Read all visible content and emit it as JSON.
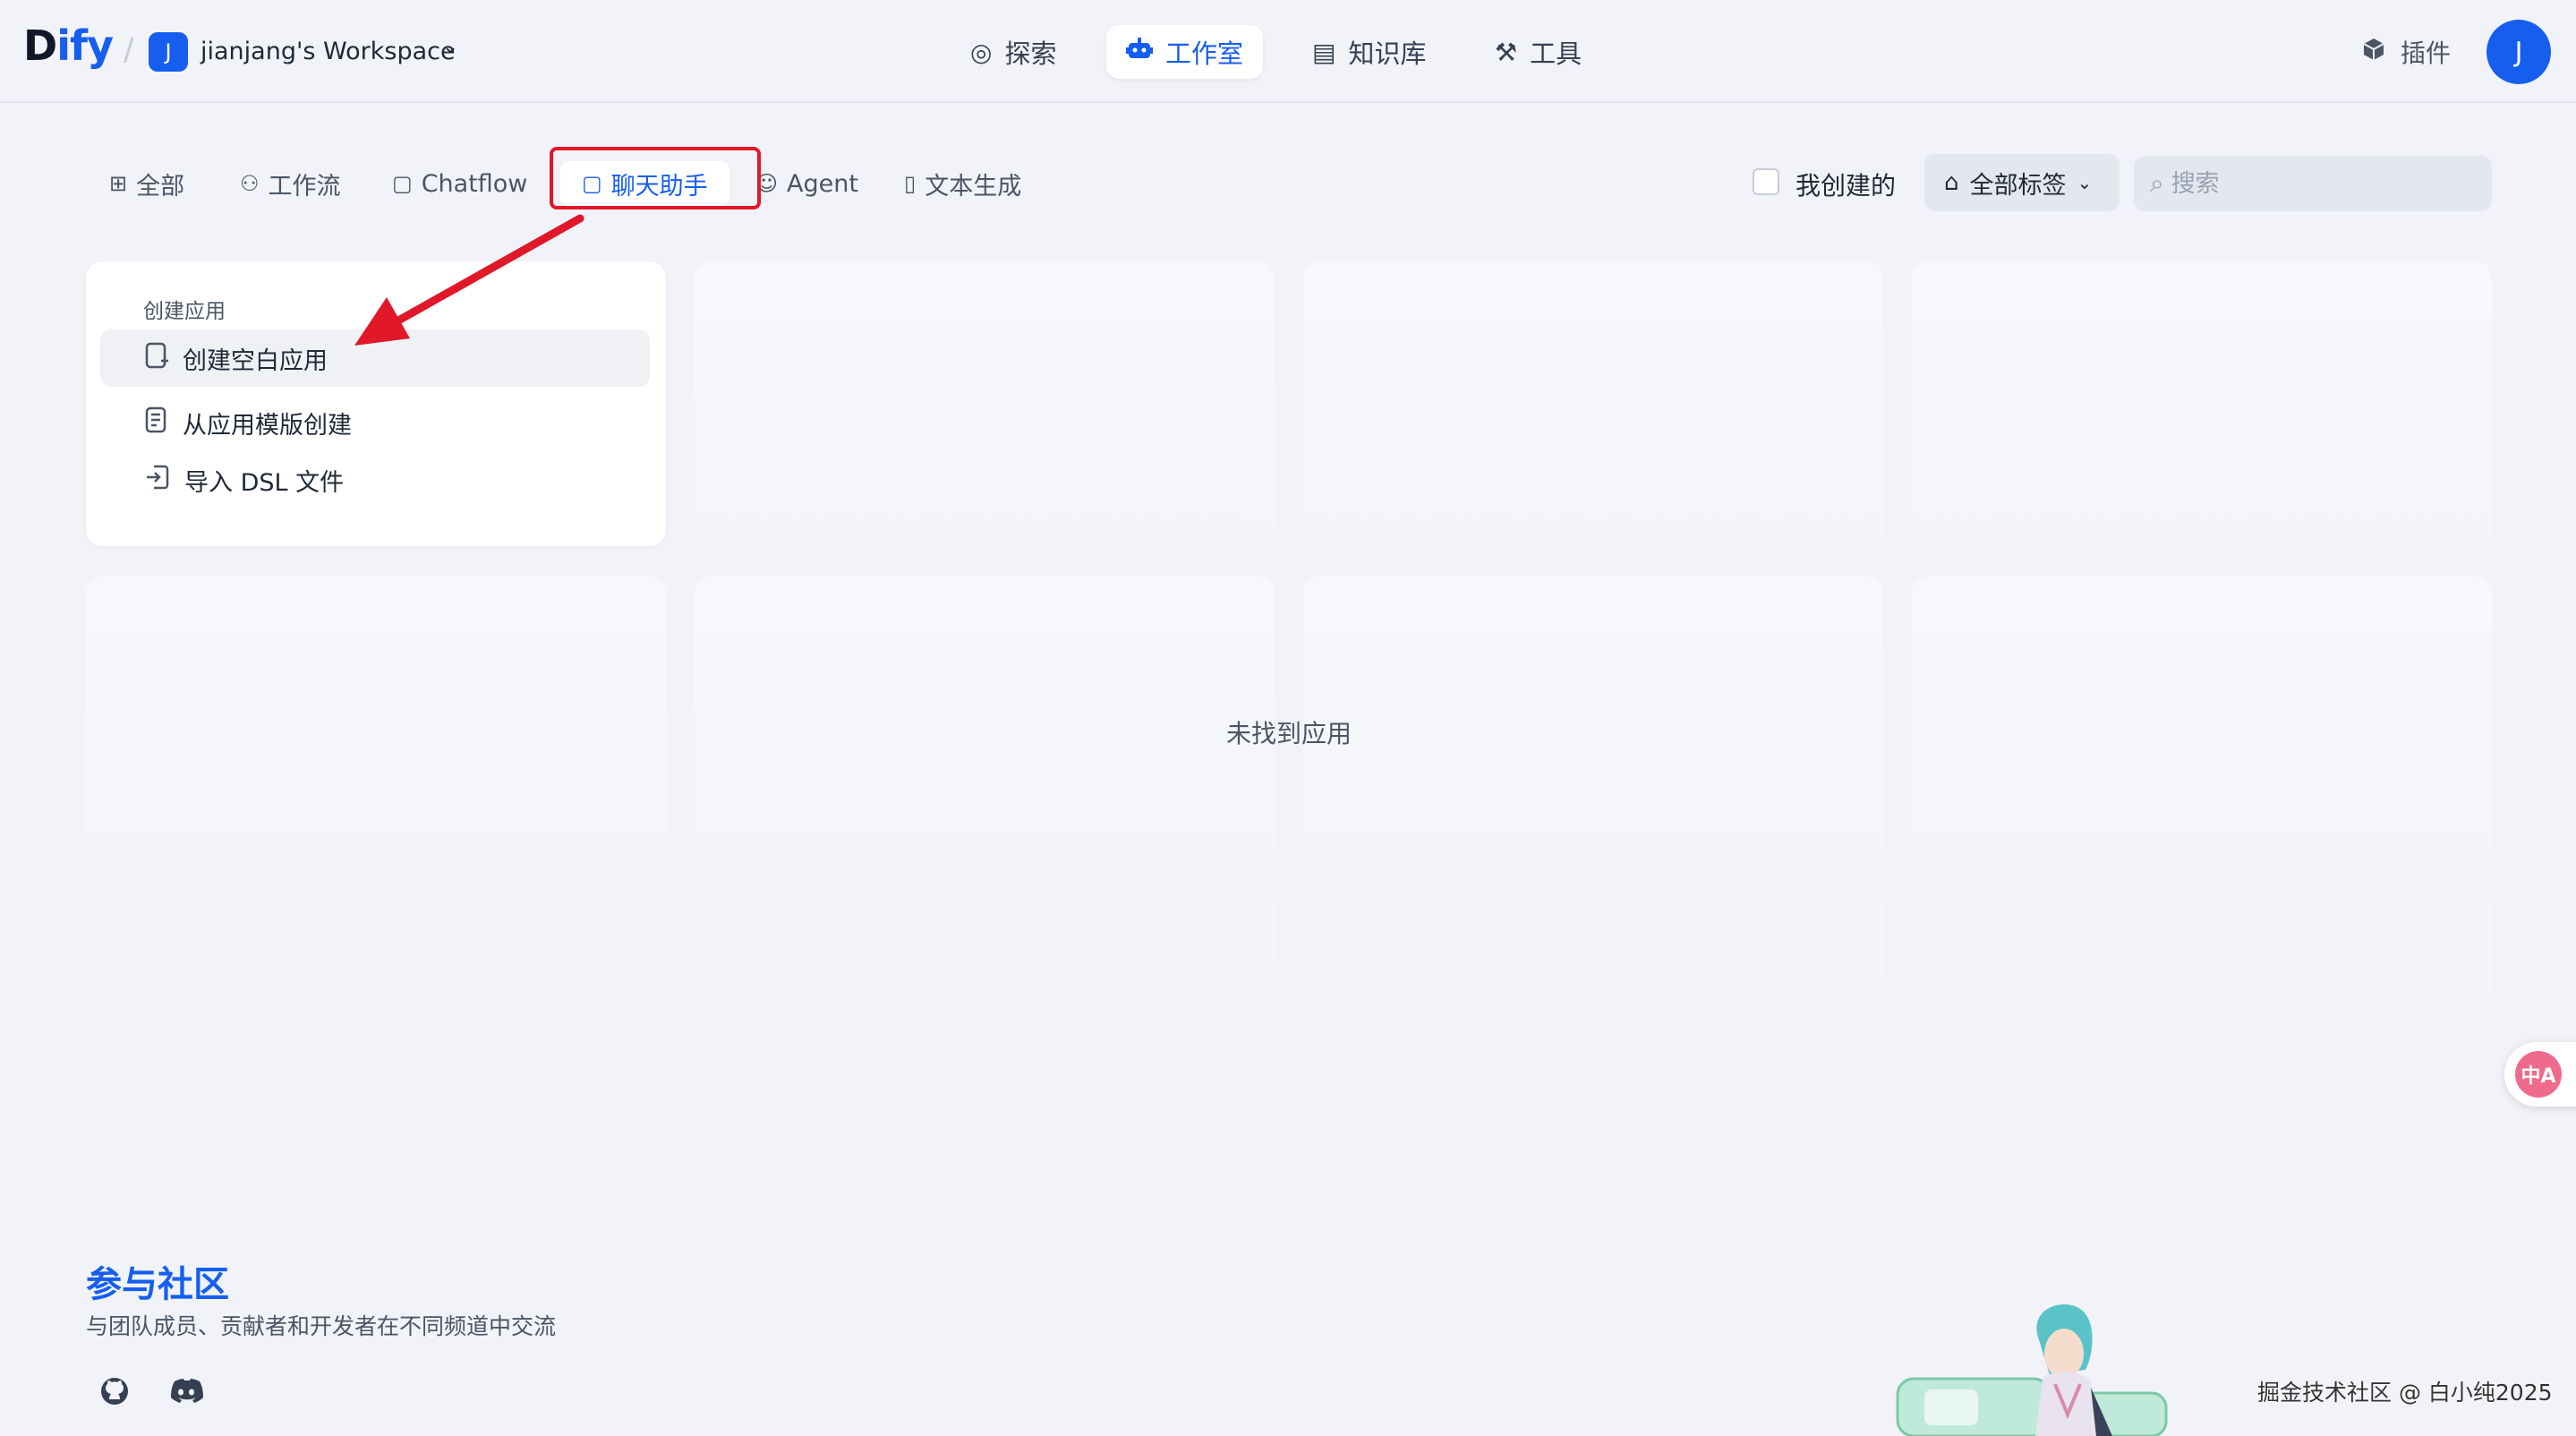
{
  "header": {
    "logo_prefix": "D",
    "logo_accent": "ify",
    "workspace_initial": "J",
    "workspace_name": "jianjang's Workspace",
    "nav": [
      {
        "label": "探索",
        "icon": "compass-icon"
      },
      {
        "label": "工作室",
        "icon": "robot-icon",
        "active": true
      },
      {
        "label": "知识库",
        "icon": "book-icon"
      },
      {
        "label": "工具",
        "icon": "hammer-icon"
      }
    ],
    "plugin_label": "插件",
    "user_initial": "J"
  },
  "tabs": [
    {
      "label": "全部",
      "icon": "grid-icon"
    },
    {
      "label": "工作流",
      "icon": "workflow-icon"
    },
    {
      "label": "Chatflow",
      "icon": "chat-icon"
    },
    {
      "label": "聊天助手",
      "icon": "chat-bot-icon",
      "active": true
    },
    {
      "label": "Agent",
      "icon": "agent-icon"
    },
    {
      "label": "文本生成",
      "icon": "document-icon"
    }
  ],
  "filters": {
    "mine_label": "我创建的",
    "tags_label": "全部标签",
    "search_placeholder": "搜索"
  },
  "create_card": {
    "title": "创建应用",
    "items": [
      {
        "label": "创建空白应用",
        "icon": "new-file-icon"
      },
      {
        "label": "从应用模版创建",
        "icon": "template-icon"
      },
      {
        "label": "导入 DSL 文件",
        "icon": "import-icon"
      }
    ]
  },
  "empty_state": "未找到应用",
  "community": {
    "title": "参与社区",
    "subtitle": "与团队成员、贡献者和开发者在不同频道中交流"
  },
  "translate_badge": "中A",
  "watermark": "掘金技术社区 @ 白小纯2025",
  "colors": {
    "accent": "#155eef",
    "highlight_box": "#e0182a",
    "background": "#f1f3f8"
  }
}
